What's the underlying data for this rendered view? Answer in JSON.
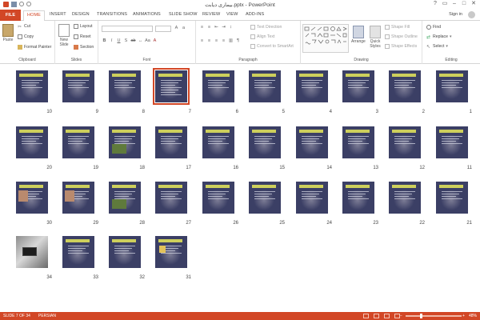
{
  "window": {
    "title": "بیماری دیابت.pptx - PowerPoint"
  },
  "tabs": [
    "FILE",
    "HOME",
    "INSERT",
    "DESIGN",
    "TRANSITIONS",
    "ANIMATIONS",
    "SLIDE SHOW",
    "REVIEW",
    "VIEW",
    "ADD-INS"
  ],
  "active_tab": "HOME",
  "account": {
    "signin": "Sign in"
  },
  "ribbon": {
    "clipboard": {
      "label": "Clipboard",
      "paste": "Paste",
      "cut": "Cut",
      "copy": "Copy",
      "format_painter": "Format Painter"
    },
    "slides": {
      "label": "Slides",
      "new_slide": "New",
      "new_slide2": "Slide",
      "layout": "Layout",
      "reset": "Reset",
      "section": "Section"
    },
    "font": {
      "label": "Font"
    },
    "paragraph": {
      "label": "Paragraph",
      "text_direction": "Text Direction",
      "align_text": "Align Text",
      "convert_smartart": "Convert to SmartArt"
    },
    "drawing": {
      "label": "Drawing",
      "arrange": "Arrange",
      "quick_styles": "Quick",
      "quick_styles2": "Styles",
      "shape_fill": "Shape Fill",
      "shape_outline": "Shape Outline",
      "shape_effects": "Shape Effects"
    },
    "editing": {
      "label": "Editing",
      "find": "Find",
      "replace": "Replace",
      "select": "Select"
    }
  },
  "sorter": {
    "selected": "7",
    "slides": [
      {
        "n": "10"
      },
      {
        "n": "9"
      },
      {
        "n": "8"
      },
      {
        "n": "7"
      },
      {
        "n": "6"
      },
      {
        "n": "5"
      },
      {
        "n": "4"
      },
      {
        "n": "3"
      },
      {
        "n": "2"
      },
      {
        "n": "1"
      },
      {
        "n": "20"
      },
      {
        "n": "19"
      },
      {
        "n": "18"
      },
      {
        "n": "17"
      },
      {
        "n": "16"
      },
      {
        "n": "15"
      },
      {
        "n": "14"
      },
      {
        "n": "13"
      },
      {
        "n": "12"
      },
      {
        "n": "11"
      },
      {
        "n": "30"
      },
      {
        "n": "29"
      },
      {
        "n": "28"
      },
      {
        "n": "27"
      },
      {
        "n": "26"
      },
      {
        "n": "25"
      },
      {
        "n": "24"
      },
      {
        "n": "23"
      },
      {
        "n": "22"
      },
      {
        "n": "21"
      },
      {
        "n": "34"
      },
      {
        "n": "33"
      },
      {
        "n": "32"
      },
      {
        "n": "31"
      }
    ]
  },
  "status": {
    "slide_info": "SLIDE 7 OF 34",
    "language": "PERSIAN",
    "zoom_minus": "−",
    "zoom_plus": "+",
    "zoom": "48%",
    "zoom_level": 0.48
  },
  "colors": {
    "accent": "#d24726",
    "slide_bg": "#3b3f65",
    "title_yellow": "#e7e95a"
  }
}
